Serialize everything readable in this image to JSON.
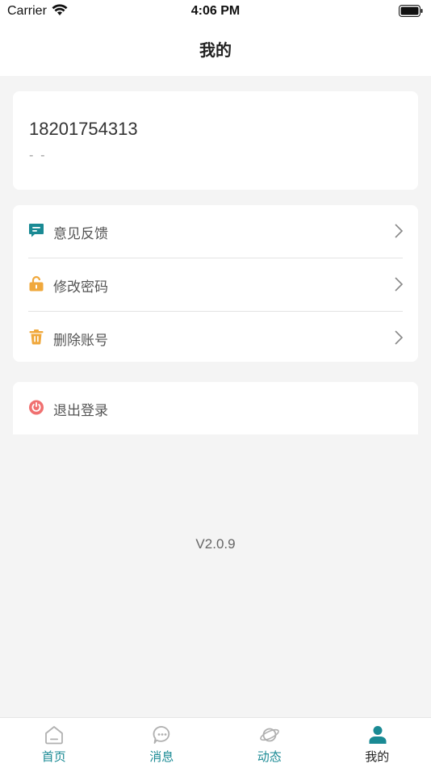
{
  "status_bar": {
    "carrier": "Carrier",
    "time": "4:06 PM"
  },
  "header": {
    "title": "我的"
  },
  "profile": {
    "phone": "18201754313",
    "subtitle": "- -"
  },
  "menu": {
    "items": [
      {
        "label": "意见反馈",
        "icon": "feedback-icon"
      },
      {
        "label": "修改密码",
        "icon": "lock-icon"
      },
      {
        "label": "删除账号",
        "icon": "trash-icon"
      }
    ]
  },
  "logout": {
    "label": "退出登录",
    "icon": "power-icon"
  },
  "version": "V2.0.9",
  "tabbar": {
    "tabs": [
      {
        "label": "首页",
        "icon": "home-icon"
      },
      {
        "label": "消息",
        "icon": "message-icon"
      },
      {
        "label": "动态",
        "icon": "planet-icon"
      },
      {
        "label": "我的",
        "icon": "user-icon",
        "active": true
      }
    ]
  },
  "colors": {
    "accent": "#1a8a94",
    "feedback": "#1a8a94",
    "lock": "#f0a83c",
    "trash": "#f0a83c",
    "power": "#f07070",
    "background": "#f4f4f4"
  }
}
